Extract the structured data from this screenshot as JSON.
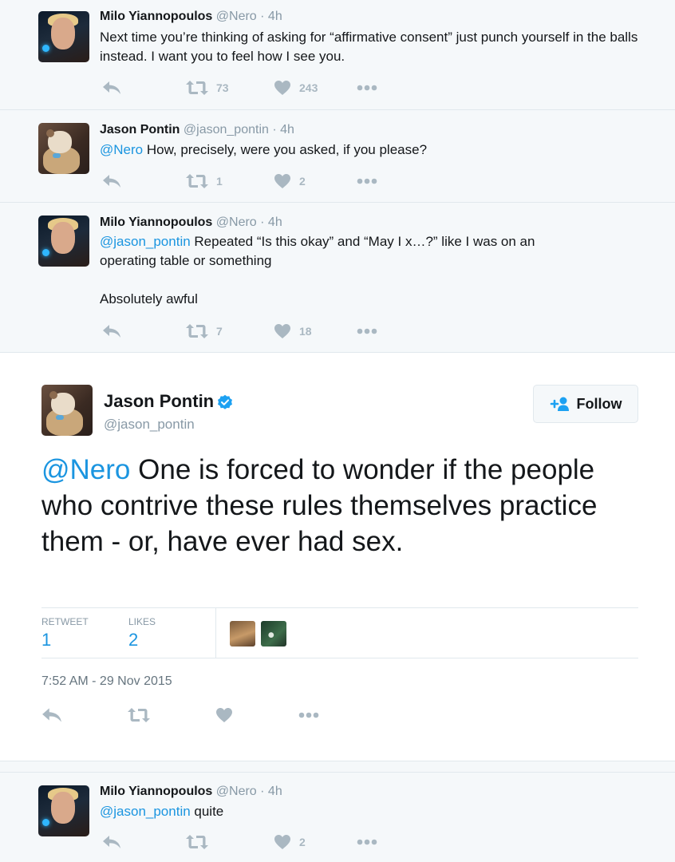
{
  "tweets": [
    {
      "name": "Milo Yiannopoulos",
      "handle": "@Nero",
      "time": "· 4h",
      "text": "Next time you’re thinking of asking for “affirmative consent” just punch yourself in the balls instead. I want you to feel how I see you.",
      "retweets": "73",
      "likes": "243"
    },
    {
      "name": "Jason Pontin",
      "handle": "@jason_pontin",
      "time": "· 4h",
      "mention": "@Nero",
      "text": " How, precisely, were you asked, if you please?",
      "retweets": "1",
      "likes": "2"
    },
    {
      "name": "Milo Yiannopoulos",
      "handle": "@Nero",
      "time": "· 4h",
      "mention": "@jason_pontin",
      "text": " Repeated “Is this okay” and “May I x…?” like I was on an operating table or something\n\nAbsolutely awful",
      "retweets": "7",
      "likes": "18"
    },
    {
      "name": "Milo Yiannopoulos",
      "handle": "@Nero",
      "time": "· 4h",
      "mention": "@jason_pontin",
      "text": " quite",
      "retweets": "",
      "likes": "2"
    }
  ],
  "main": {
    "name": "Jason Pontin",
    "handle": "@jason_pontin",
    "follow_label": "Follow",
    "mention": "@Nero",
    "text": " One is forced to wonder if the people who contrive these rules themselves practice them - or, have ever had sex.",
    "retweet_label": "RETWEET",
    "retweet_count": "1",
    "likes_label": "LIKES",
    "likes_count": "2",
    "timestamp": "7:52 AM - 29 Nov 2015"
  },
  "icons": [
    "reply-icon",
    "retweet-icon",
    "heart-icon",
    "more-icon",
    "verified-icon",
    "follow-user-icon"
  ],
  "colors": {
    "link": "#1b95e0",
    "icon": "#aab8c2",
    "background": "#f5f8fa",
    "verified": "#1da1f2"
  }
}
